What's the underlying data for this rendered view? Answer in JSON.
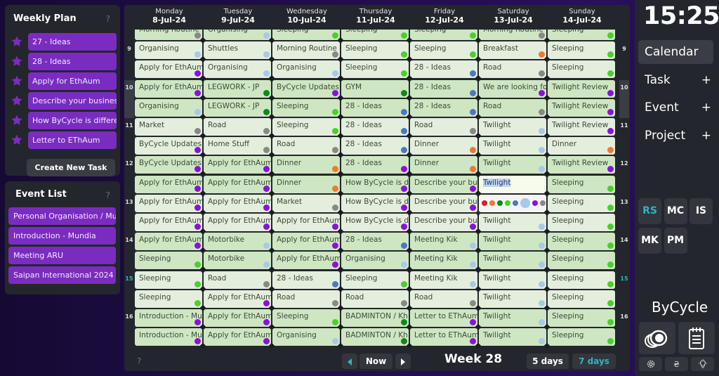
{
  "weekly_plan": {
    "title": "Weekly Plan",
    "help": "?",
    "items": [
      "27 - Ideas",
      "28 - Ideas",
      "Apply for EthAum",
      "Describe your business",
      "How ByCycle is differen",
      "Letter to EThAum"
    ],
    "create_button": "Create New Task"
  },
  "event_list": {
    "title": "Event List",
    "help": "?",
    "items": [
      "Personal Organisation / Mu",
      "Introduction - Mundia",
      "Meeting ARU",
      "Saipan International 2024"
    ]
  },
  "calendar": {
    "days": [
      {
        "name": "Monday",
        "date": "8-Jul-24"
      },
      {
        "name": "Tuesday",
        "date": "9-Jul-24"
      },
      {
        "name": "Wednesday",
        "date": "10-Jul-24"
      },
      {
        "name": "Thursday",
        "date": "11-Jul-24"
      },
      {
        "name": "Friday",
        "date": "12-Jul-24"
      },
      {
        "name": "Saturday",
        "date": "13-Jul-24"
      },
      {
        "name": "Sunday",
        "date": "14-Jul-24"
      }
    ],
    "hours": [
      "9",
      "10",
      "11",
      "12",
      "13",
      "14",
      "15",
      "16"
    ],
    "current_hour": "15",
    "highlight_hour_right": "10",
    "colors": {
      "red": "#d62020",
      "orange": "#ee7a30",
      "darkgreen": "#0d8a1a",
      "green": "#48d12a",
      "blue": "#4a78c8",
      "lightblue": "#a8c8ec",
      "purple": "#8b10e0",
      "gray": "#888888"
    },
    "rows": [
      [
        [
          "Morning Routine",
          "gray"
        ],
        [
          "Organising",
          "lightblue"
        ],
        [
          "Sleeping",
          "green"
        ],
        [
          "Sleeping",
          "green"
        ],
        [
          "Sleeping",
          "green"
        ],
        [
          "Morning Routine",
          "gray"
        ],
        [
          "Sleeping",
          "green"
        ]
      ],
      [
        [
          "Organising",
          "lightblue"
        ],
        [
          "Shuttles",
          "lightblue"
        ],
        [
          "Morning Routine",
          "gray"
        ],
        [
          "Sleeping",
          "green"
        ],
        [
          "Sleeping",
          "green"
        ],
        [
          "Breakfast",
          "orange"
        ],
        [
          "Sleeping",
          "green"
        ]
      ],
      [
        [
          "Apply for EthAum",
          "purple"
        ],
        [
          "Organising",
          "lightblue"
        ],
        [
          "Organising",
          "lightblue"
        ],
        [
          "Sleeping",
          "green"
        ],
        [
          "28 - Ideas",
          "blue"
        ],
        [
          "Road",
          "gray"
        ],
        [
          "Sleeping",
          "green"
        ]
      ],
      [
        [
          "Apply for EthAum",
          "purple"
        ],
        [
          "LEGWORK - JP",
          "darkgreen"
        ],
        [
          "ByCycle Updates",
          "purple"
        ],
        [
          "GYM",
          "darkgreen"
        ],
        [
          "28 - Ideas",
          "blue"
        ],
        [
          "We are looking fo",
          "purple"
        ],
        [
          "Twilight Review",
          "purple"
        ]
      ],
      [
        [
          "Organising",
          "lightblue"
        ],
        [
          "LEGWORK - JP",
          "darkgreen"
        ],
        [
          "Sleeping",
          "green"
        ],
        [
          "28 - Ideas",
          "blue"
        ],
        [
          "28 - Ideas",
          "blue"
        ],
        [
          "Road",
          "gray"
        ],
        [
          "Twilight Review",
          "purple"
        ]
      ],
      [
        [
          "Market",
          "gray"
        ],
        [
          "Road",
          "gray"
        ],
        [
          "Sleeping",
          "green"
        ],
        [
          "28 - Ideas",
          "blue"
        ],
        [
          "Road",
          "gray"
        ],
        [
          "Twilight",
          "lightblue"
        ],
        [
          "Twilight Review",
          "purple"
        ]
      ],
      [
        [
          "ByCycle Updates",
          "purple"
        ],
        [
          "Home Stuff",
          "gray"
        ],
        [
          "Road",
          "gray"
        ],
        [
          "28 - Ideas",
          "blue"
        ],
        [
          "Dinner",
          "orange"
        ],
        [
          "Twilight",
          "lightblue"
        ],
        [
          "Dinner",
          "orange"
        ]
      ],
      [
        [
          "ByCycle Updates",
          "purple"
        ],
        [
          "Apply for EthAum",
          "purple"
        ],
        [
          "Dinner",
          "orange"
        ],
        [
          "28 - Ideas",
          "purple"
        ],
        [
          "Dinner",
          "orange"
        ],
        [
          "Twilight",
          "lightblue"
        ],
        [
          "Twilight Review",
          "purple"
        ]
      ],
      [
        [
          "Apply for EthAum",
          "purple"
        ],
        [
          "Apply for EthAum",
          "purple"
        ],
        [
          "Dinner",
          "orange"
        ],
        [
          "How ByCycle is d",
          "purple"
        ],
        [
          "Describe your bu",
          "purple"
        ],
        [
          "Twilight",
          "active"
        ],
        [
          "Sleeping",
          "green"
        ]
      ],
      [
        [
          "Apply for EthAum",
          "purple"
        ],
        [
          "Apply for EthAum",
          "purple"
        ],
        [
          "Market",
          "gray"
        ],
        [
          "How ByCycle is d",
          "purple"
        ],
        [
          "Describe your bu",
          "purple"
        ],
        [
          "",
          "palette"
        ],
        [
          "Sleeping",
          "green"
        ]
      ],
      [
        [
          "Apply for EthAum",
          "purple"
        ],
        [
          "Apply for EthAum",
          "purple"
        ],
        [
          "Apply for EthAum",
          "purple"
        ],
        [
          "How ByCycle is d",
          "purple"
        ],
        [
          "Describe your bu",
          "purple"
        ],
        [
          "Twilight",
          "lightblue"
        ],
        [
          "Sleeping",
          "green"
        ]
      ],
      [
        [
          "Apply for EthAum",
          "purple"
        ],
        [
          "Motorbike",
          "lightblue"
        ],
        [
          "Apply for EthAum",
          "purple"
        ],
        [
          "28 - Ideas",
          "blue"
        ],
        [
          "Meeting Kik",
          "lightblue"
        ],
        [
          "Twilight",
          "lightblue"
        ],
        [
          "Sleeping",
          "green"
        ]
      ],
      [
        [
          "Sleeping",
          "green"
        ],
        [
          "Motorbike",
          "lightblue"
        ],
        [
          "Apply for EthAum",
          "purple"
        ],
        [
          "Organising",
          "lightblue"
        ],
        [
          "Meeting Kik",
          "lightblue"
        ],
        [
          "Twilight",
          "lightblue"
        ],
        [
          "Sleeping",
          "green"
        ]
      ],
      [
        [
          "Sleeping",
          "green"
        ],
        [
          "Road",
          "gray"
        ],
        [
          "28 - Ideas",
          "blue"
        ],
        [
          "Sleeping",
          "green"
        ],
        [
          "Meeting Kik",
          "lightblue"
        ],
        [
          "Twilight",
          "lightblue"
        ],
        [
          "Sleeping",
          "green"
        ]
      ],
      [
        [
          "Sleeping",
          "green"
        ],
        [
          "Apply for EthAum",
          "purple"
        ],
        [
          "Road",
          "gray"
        ],
        [
          "Road",
          "gray"
        ],
        [
          "Road",
          "gray"
        ],
        [
          "Twilight",
          "lightblue"
        ],
        [
          "Sleeping",
          "green"
        ]
      ],
      [
        [
          "Introduction - Mu",
          "purple"
        ],
        [
          "Apply for EthAum",
          "purple"
        ],
        [
          "Sleeping",
          "green"
        ],
        [
          "BADMINTON / Kh",
          "darkgreen"
        ],
        [
          "Letter to EThAum",
          "purple"
        ],
        [
          "Twilight",
          "lightblue"
        ],
        [
          "Sleeping",
          "green"
        ]
      ],
      [
        [
          "Introduction - Mu",
          "purple"
        ],
        [
          "Apply for EthAum",
          "purple"
        ],
        [
          "Organising",
          "lightblue"
        ],
        [
          "BADMINTON / Kh",
          "darkgreen"
        ],
        [
          "Letter to EThAum",
          "purple"
        ],
        [
          "Twilight",
          "lightblue"
        ],
        [
          "Sleeping",
          "green"
        ]
      ]
    ],
    "palette_colors": [
      "red",
      "orange",
      "darkgreen",
      "green",
      "blue",
      "lightblue",
      "purple",
      "gray"
    ],
    "palette_selected": "lightblue",
    "toolbar": {
      "help": "?",
      "now_label": "Now",
      "week_label": "Week 28",
      "five_days": "5 days",
      "seven_days": "7 days",
      "active_view": "7 days"
    }
  },
  "sidebar": {
    "clock": "15:25",
    "nav": [
      {
        "label": "Calendar",
        "plus": "",
        "active": true
      },
      {
        "label": "Task",
        "plus": "+"
      },
      {
        "label": "Event",
        "plus": "+"
      },
      {
        "label": "Project",
        "plus": "+"
      }
    ],
    "users": [
      "RS",
      "MC",
      "IS",
      "MK",
      "PM"
    ],
    "active_user": "RS",
    "brand": "ByCycle",
    "icons": [
      "coins-icon",
      "notepad-icon",
      "gear-icon",
      "currency-icon",
      "lightbulb-icon"
    ]
  },
  "accent": "#2bb6c4",
  "task_purple": "#7b2cc0"
}
